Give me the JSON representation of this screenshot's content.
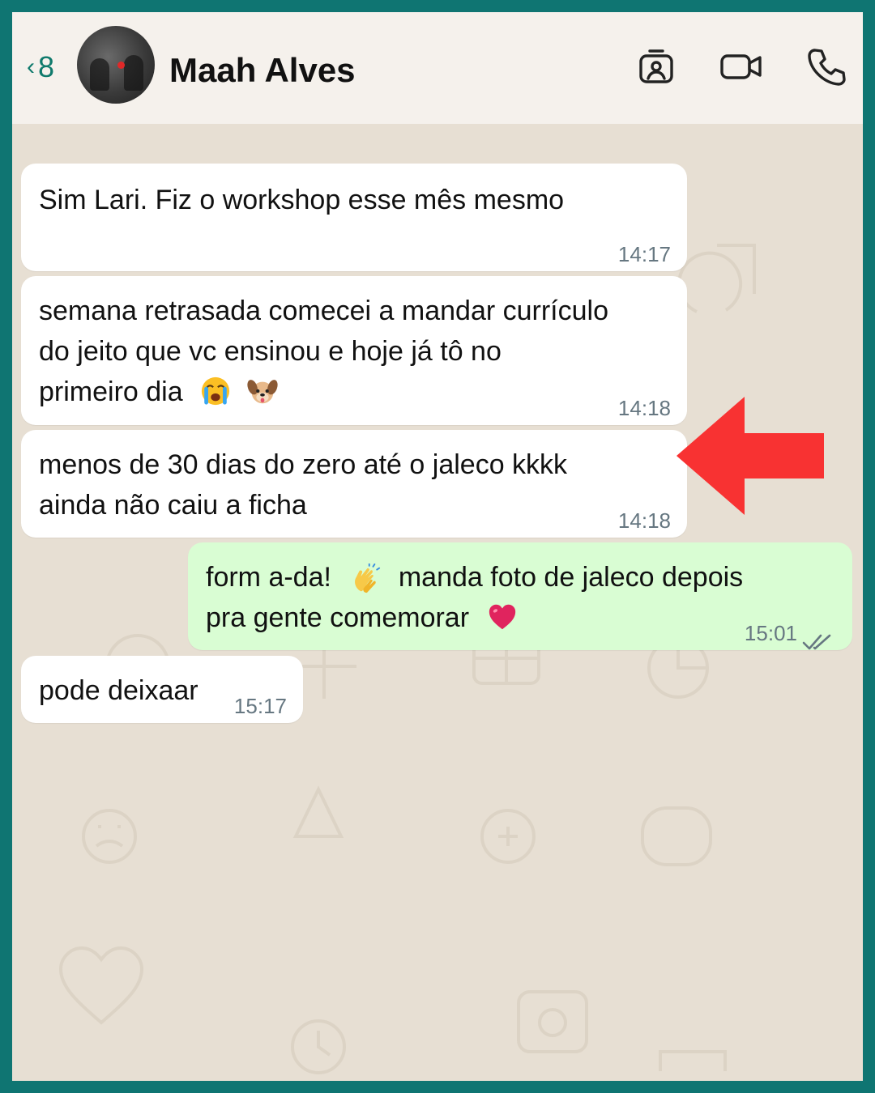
{
  "header": {
    "back_count": "8",
    "contact_name": "Maah Alves"
  },
  "messages": [
    {
      "direction": "incoming",
      "lines": [
        "Sim Lari. Fiz o workshop esse mês mesmo"
      ],
      "time": "14:17"
    },
    {
      "direction": "incoming",
      "lines": [
        "semana retrasada comecei a mandar currículo",
        "do jeito que vc ensinou e hoje já tô no",
        "primeiro dia"
      ],
      "emojis": [
        "crying-face-emoji",
        "dog-face-emoji"
      ],
      "time": "14:18"
    },
    {
      "direction": "incoming",
      "lines": [
        "menos de 30 dias do zero até o jaleco kkkk",
        "ainda não caiu a ficha"
      ],
      "time": "14:18"
    },
    {
      "direction": "outgoing",
      "lines": [
        "form a-da!",
        "manda foto de jaleco depois",
        "pra gente comemorar"
      ],
      "emojis": [
        "clapping-hands-emoji",
        "red-heart-emoji"
      ],
      "time": "15:01",
      "status": "read"
    },
    {
      "direction": "incoming",
      "lines": [
        "pode deixaar"
      ],
      "time": "15:17"
    }
  ],
  "colors": {
    "frame": "#0f7572",
    "chat_background": "#e7dfd3",
    "header_background": "#f5f1ec",
    "incoming_bubble": "#ffffff",
    "outgoing_bubble": "#d9fdd3",
    "accent_green": "#0f7a6c",
    "annotation_arrow": "#f83232"
  },
  "icons": [
    "chevron-left-icon",
    "contact-card-icon",
    "video-call-icon",
    "phone-icon",
    "double-check-icon"
  ]
}
